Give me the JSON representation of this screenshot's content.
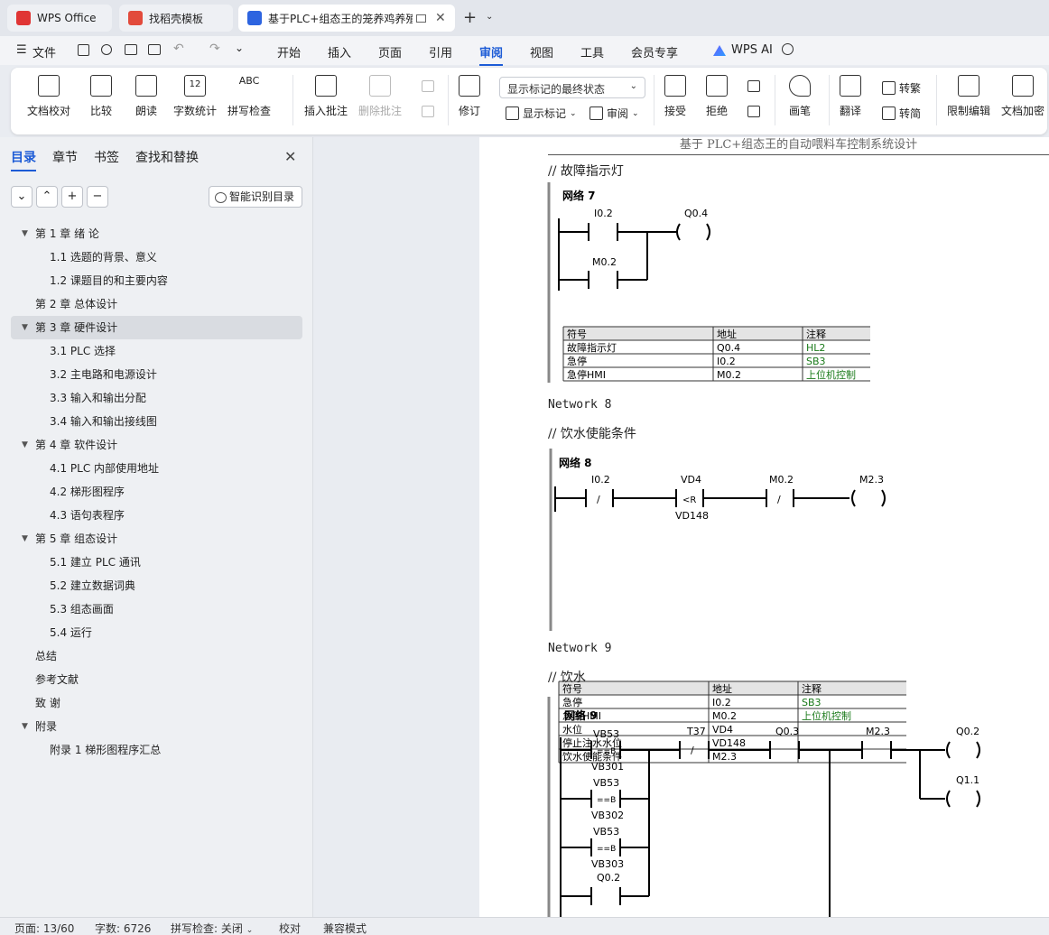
{
  "tabs": [
    {
      "label": "WPS Office",
      "color": "#e03535"
    },
    {
      "label": "找稻壳模板",
      "color": "#e24a3b"
    },
    {
      "label": "基于PLC+组态王的笼养鸡养殖",
      "color": "#2d64e0"
    }
  ],
  "menu": {
    "file": "文件",
    "items": [
      "开始",
      "插入",
      "页面",
      "引用",
      "审阅",
      "视图",
      "工具",
      "会员专享"
    ],
    "active": "审阅",
    "ai": "WPS AI"
  },
  "ribbon": {
    "buttons": [
      "文档校对",
      "比较",
      "朗读",
      "字数统计",
      "拼写检查",
      "插入批注",
      "删除批注",
      "修订",
      "接受",
      "拒绝",
      "画笔",
      "翻译",
      "限制编辑",
      "文档加密"
    ],
    "icon_texts": {
      "wordcount": "12",
      "spell": "ABC"
    },
    "select": "显示标记的最终状态",
    "show_markup": "显示标记",
    "review": "审阅",
    "trad": "转繁",
    "simp": "转简"
  },
  "sidebar": {
    "tabs": [
      "目录",
      "章节",
      "书签",
      "查找和替换"
    ],
    "smart": "智能识别目录",
    "toc": [
      {
        "label": "第 1 章   绪  论",
        "level": 1,
        "tri": true
      },
      {
        "label": "1.1 选题的背景、意义",
        "level": 2
      },
      {
        "label": "1.2 课题目的和主要内容",
        "level": 2
      },
      {
        "label": "第 2 章   总体设计",
        "level": 1
      },
      {
        "label": "第 3 章   硬件设计",
        "level": 1,
        "tri": true,
        "selected": true
      },
      {
        "label": "3.1 PLC 选择",
        "level": 2
      },
      {
        "label": "3.2  主电路和电源设计",
        "level": 2
      },
      {
        "label": "3.3  输入和输出分配",
        "level": 2
      },
      {
        "label": "3.4  输入和输出接线图",
        "level": 2
      },
      {
        "label": "第 4 章   软件设计",
        "level": 1,
        "tri": true
      },
      {
        "label": "4.1 PLC 内部使用地址",
        "level": 2
      },
      {
        "label": "4.2  梯形图程序",
        "level": 2
      },
      {
        "label": "4.3  语句表程序",
        "level": 2
      },
      {
        "label": "第 5 章   组态设计",
        "level": 1,
        "tri": true
      },
      {
        "label": "5.1 建立 PLC 通讯",
        "level": 2
      },
      {
        "label": "5.2  建立数据词典",
        "level": 2
      },
      {
        "label": "5.3  组态画面",
        "level": 2
      },
      {
        "label": "5.4 运行",
        "level": 2
      },
      {
        "label": "总结",
        "level": 1
      },
      {
        "label": "参考文献",
        "level": 1
      },
      {
        "label": "致  谢",
        "level": 1
      },
      {
        "label": "附录",
        "level": 1,
        "tri": true
      },
      {
        "label": "附录 1  梯形图程序汇总",
        "level": 2
      }
    ]
  },
  "doc": {
    "header": "基于 PLC+组态王的自动喂料车控制系统设计",
    "comment7": "// 故障指示灯",
    "net8": "Network 8",
    "comment8": "// 饮水使能条件",
    "net9": "Network 9",
    "comment9": "// 饮水",
    "n7": {
      "title": "网络 7",
      "i02": "I0.2",
      "q04": "Q0.4",
      "m02": "M0.2",
      "table": {
        "headers": [
          "符号",
          "地址",
          "注释"
        ],
        "rows": [
          [
            "故障指示灯",
            "Q0.4",
            "HL2"
          ],
          [
            "急停",
            "I0.2",
            "SB3"
          ],
          [
            "急停HMI",
            "M0.2",
            "上位机控制"
          ]
        ]
      }
    },
    "n8": {
      "title": "网络 8",
      "i02": "I0.2",
      "vd4": "VD4",
      "cmp": "<R",
      "vd148": "VD148",
      "m02": "M0.2",
      "m23": "M2.3",
      "neg": "/",
      "table": {
        "headers": [
          "符号",
          "地址",
          "注释"
        ],
        "rows": [
          [
            "急停",
            "I0.2",
            "SB3"
          ],
          [
            "急停HMI",
            "M0.2",
            "上位机控制"
          ],
          [
            "水位",
            "VD4",
            ""
          ],
          [
            "停止注水水位",
            "VD148",
            ""
          ],
          [
            "饮水使能条件",
            "M2.3",
            ""
          ]
        ]
      }
    },
    "n9": {
      "title": "网络 9",
      "vb53": "VB53",
      "eqb": "==B",
      "vb301": "VB301",
      "vb302": "VB302",
      "vb303": "VB303",
      "q02b": "Q0.2",
      "t37": "T37",
      "q03": "Q0.3",
      "m23": "M2.3",
      "q02": "Q0.2",
      "q11": "Q1.1",
      "neg": "/"
    }
  },
  "status": {
    "page": "页面: 13/60",
    "words": "字数: 6726",
    "spell": "拼写检查: 关闭",
    "proof": "校对",
    "compat": "兼容模式"
  },
  "colors": {
    "accent": "#1c5bd6",
    "comment_green": "#1a7a1a"
  }
}
